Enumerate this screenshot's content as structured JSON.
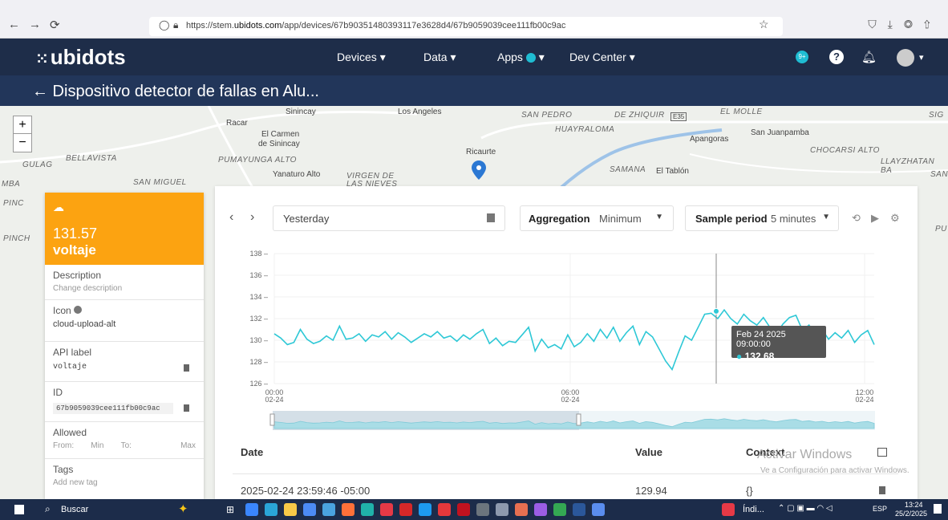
{
  "browser": {
    "url_prefix": "https://stem.",
    "url_host": "ubidots.com",
    "url_suffix": "/app/devices/67b90351480393117e3628d4/67b9059039cee111fb00c9ac"
  },
  "appbar": {
    "logo": "ubidots",
    "menu": [
      "Devices",
      "Data",
      "Apps",
      "Dev Center"
    ],
    "badge": "9+"
  },
  "title": "← Dispositivo detector de fallas en Alu...",
  "map": {
    "labels": [
      "Racar",
      "Sinincay",
      "El Carmen",
      "de Sinincay",
      "Los Angeles",
      "Ricaurte",
      "SAN PEDRO",
      "HUAYRALOMA",
      "DE ZHIQUIR",
      "E35",
      "EL MOLLE",
      "San Juanpamba",
      "Apangoras",
      "CHOCARSI ALTO",
      "LLAYZHATAN BA",
      "SAN",
      "SIG",
      "BELLAVISTA",
      "GULAG",
      "PUMAYUNGA ALTO",
      "Yanaturo Alto",
      "VIRGEN DE",
      "LAS NIEVES",
      "SAMANA",
      "El Tablón",
      "SAN MIGUEL",
      "MBA",
      "PINC",
      "PINCH",
      "PU"
    ]
  },
  "variable": {
    "value": "131.57",
    "name": "voltaje",
    "description_label": "Description",
    "description_placeholder": "Change description",
    "icon_label": "Icon",
    "icon_value": "cloud-upload-alt",
    "api_label": "API label",
    "api_value": "voltaje",
    "id_label": "ID",
    "id_value": "67b9059039cee111fb00c9ac",
    "allowed_label": "Allowed",
    "from_label": "From:",
    "min_placeholder": "Min",
    "to_label": "To:",
    "max_placeholder": "Max",
    "tags_label": "Tags",
    "tags_placeholder": "Add new tag"
  },
  "controls": {
    "date_range": "Yesterday",
    "aggregation_label": "Aggregation",
    "aggregation_value": "Minimum",
    "sample_label": "Sample period",
    "sample_value": "5 minutes"
  },
  "chart_data": {
    "type": "line",
    "ylim": [
      126,
      138
    ],
    "yticks": [
      "138",
      "136",
      "134",
      "132",
      "130",
      "128",
      "126"
    ],
    "xticks": [
      {
        "time": "00:00",
        "date": "02-24"
      },
      {
        "time": "06:00",
        "date": "02-24"
      },
      {
        "time": "12:00",
        "date": "02-24"
      }
    ],
    "series": [
      {
        "values": [
          130.6,
          130.2,
          129.6,
          129.8,
          131.0,
          130.1,
          129.7,
          129.9,
          130.4,
          130.0,
          131.3,
          130.1,
          130.2,
          130.6,
          129.9,
          130.5,
          130.3,
          130.8,
          130.1,
          130.7,
          130.3,
          129.8,
          130.2,
          130.6,
          130.3,
          130.8,
          130.2,
          130.4,
          129.9,
          130.5,
          130.1,
          130.6,
          131.0,
          129.7,
          130.2,
          129.5,
          129.9,
          129.8,
          130.5,
          131.2,
          129.0,
          130.1,
          129.3,
          129.6,
          129.2,
          130.5,
          129.4,
          129.8,
          130.6,
          129.9,
          131.0,
          130.2,
          131.2,
          129.9,
          130.7,
          131.3,
          129.6,
          130.8,
          130.3,
          129.2,
          128.1,
          127.3,
          128.9,
          130.4,
          130.0,
          131.2,
          132.4,
          132.5,
          132.0,
          132.8,
          132.0,
          131.5,
          132.4,
          131.8,
          131.4,
          132.1,
          131.2,
          130.6,
          131.5,
          132.1,
          132.3,
          130.9,
          131.4,
          130.5,
          131.0,
          130.1,
          130.7,
          130.2,
          130.9,
          129.8,
          130.5,
          130.9,
          129.6
        ]
      }
    ],
    "tooltip": {
      "date": "Feb 24 2025 09:00:00",
      "value": "132.68"
    }
  },
  "table": {
    "headers": [
      "Date",
      "Value",
      "Context"
    ],
    "rows": [
      {
        "date": "2025-02-24 23:59:46 -05:00",
        "value": "129.94",
        "context": "{}"
      }
    ]
  },
  "watermark": {
    "title": "Activar Windows",
    "sub": "Ve a Configuración para activar Windows."
  },
  "taskbar": {
    "search": "Buscar",
    "app_label": "Índi...",
    "lang": "ESP",
    "time": "13:24",
    "date": "25/2/2025"
  }
}
